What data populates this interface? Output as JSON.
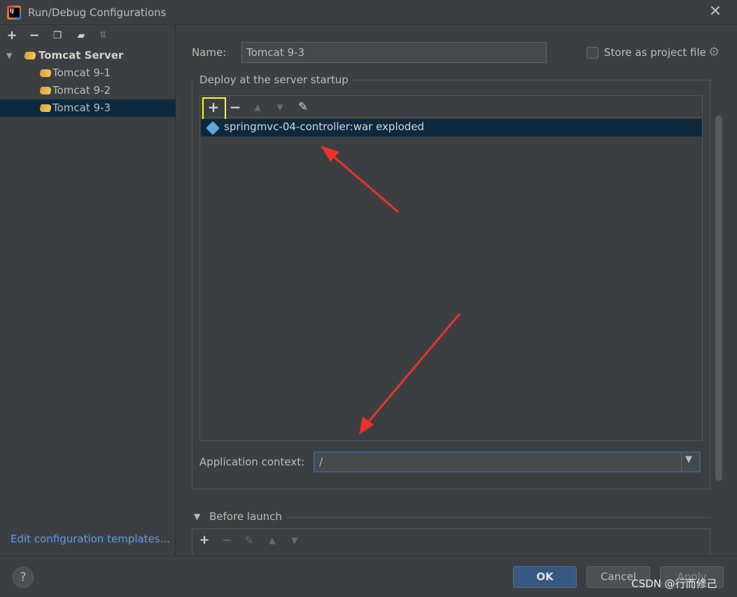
{
  "window": {
    "title": "Run/Debug Configurations"
  },
  "left_panel": {
    "tree": {
      "group_label": "Tomcat Server",
      "items": [
        {
          "label": "Tomcat 9-1",
          "selected": false
        },
        {
          "label": "Tomcat 9-2",
          "selected": false
        },
        {
          "label": "Tomcat 9-3",
          "selected": true
        }
      ]
    },
    "edit_templates_link": "Edit configuration templates..."
  },
  "config": {
    "name_label": "Name:",
    "name_value": "Tomcat 9-3",
    "store_label": "Store as project file",
    "store_checked": false
  },
  "deploy": {
    "title": "Deploy at the server startup",
    "artifacts": [
      {
        "label": "springmvc-04-controller:war exploded",
        "selected": true
      }
    ],
    "context_label": "Application context:",
    "context_value": "/"
  },
  "before_launch": {
    "title": "Before launch"
  },
  "buttons": {
    "ok": "OK",
    "cancel": "Cancel",
    "apply": "Apply",
    "help": "?"
  },
  "watermark": "CSDN @行而修己",
  "colors": {
    "background": "#3c3f41",
    "selection": "#0d293e",
    "link": "#589df6",
    "ok_button": "#365880",
    "highlight": "#ffff00",
    "annotation_arrow": "#e8322c"
  }
}
